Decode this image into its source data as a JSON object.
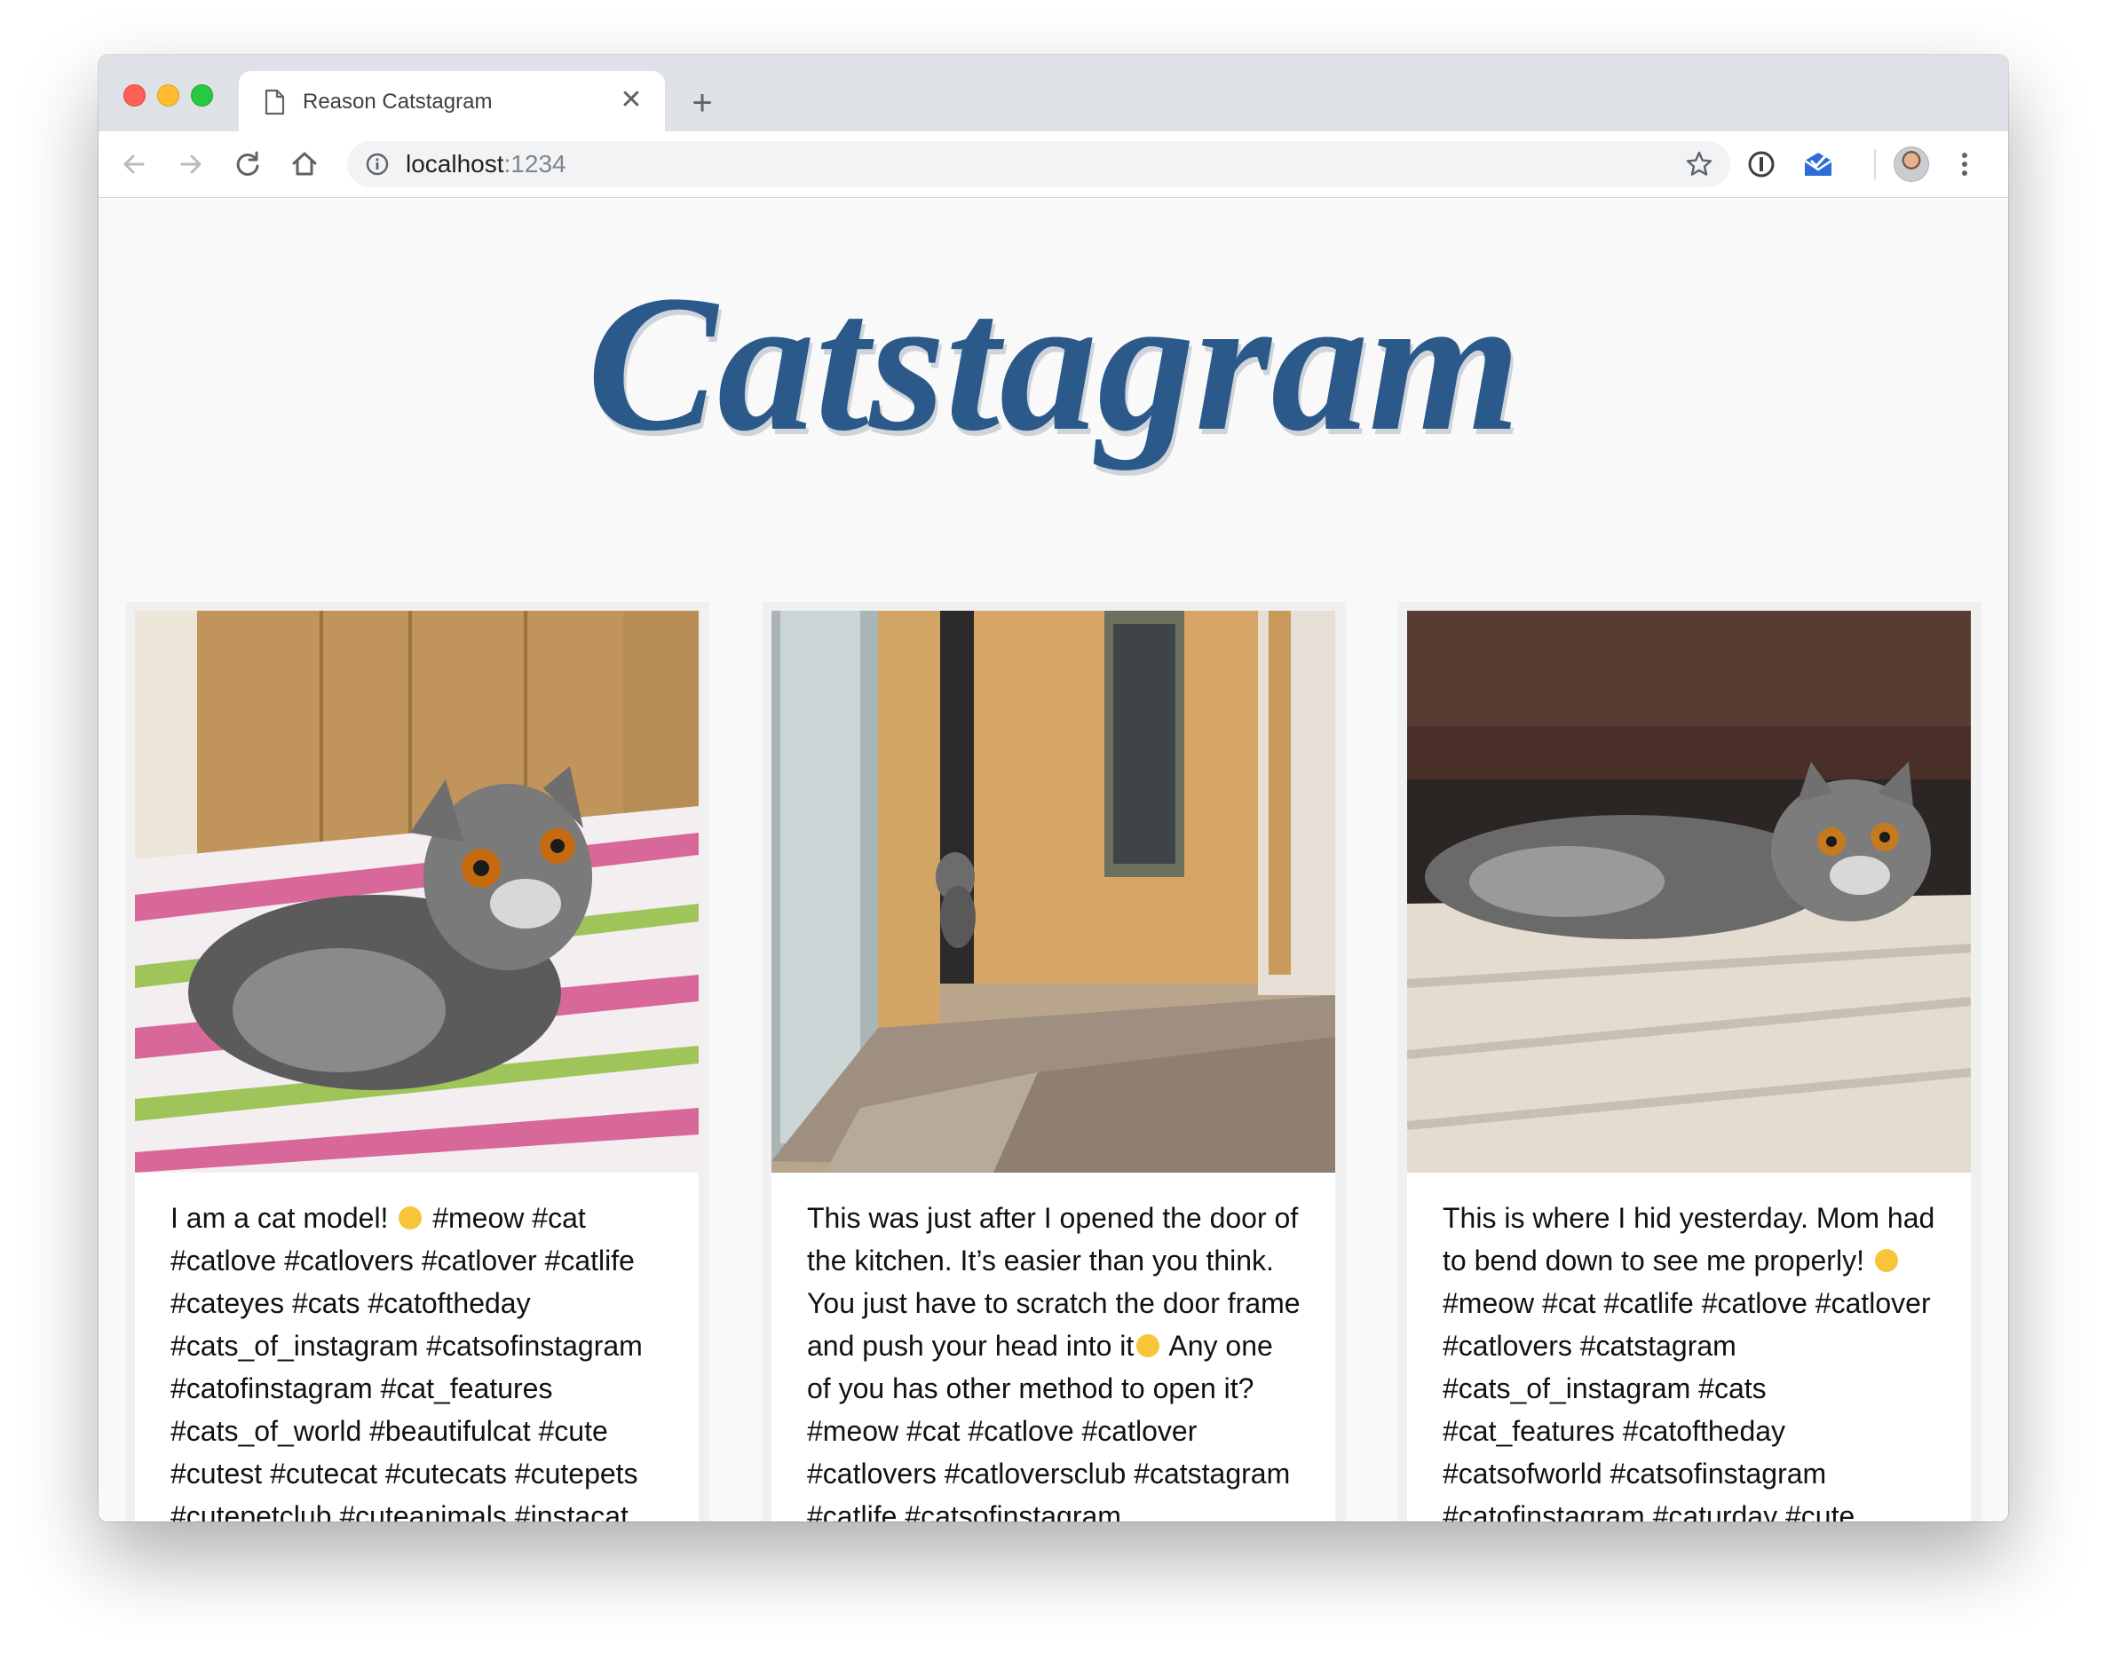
{
  "browser": {
    "tab_title": "Reason Catstagram",
    "url_host": "localhost",
    "url_port": ":1234"
  },
  "app": {
    "logo_text": "Catstagram",
    "accent_color": "#2b5a8a"
  },
  "posts": [
    {
      "caption_before": "I am a cat model! ",
      "emoji": "cat-face-icon",
      "caption_after": "  #meow #cat #catlove #catlovers #catlover #catlife #cateyes #cats #catoftheday #cats_of_instagram #catsofinstagram #catofinstagram #cat_features #cats_of_world #beautifulcat #cute #cutest #cutecat #cutecats #cutepets #cutepetclub #cuteanimals #instacat #instameow #tabbiesofinstagram"
    },
    {
      "caption_before": "This was just after I opened the door of the kitchen. It’s easier than you think. You just have to scratch the door frame and push your head into it",
      "emoji": "cat-face-icon",
      "caption_after": " Any one of you has other method to open it? #meow #cat #catlove #catlover #catlovers #catloversclub #catstagram #catlife #catsofinstagram #cats_of_instagram #cats"
    },
    {
      "caption_before": "This is where I hid yesterday. Mom had to bend down to see me properly! ",
      "emoji": "cat-face-icon",
      "caption_after": "  #meow #cat #catlife #catlove #catlover #catlovers #catstagram #cats_of_instagram #cats #cat_features #catoftheday #catsofworld #catsofinstagram #catofinstagram #caturday #cute #cutest #cutecat #cutepets #cutecats"
    }
  ]
}
